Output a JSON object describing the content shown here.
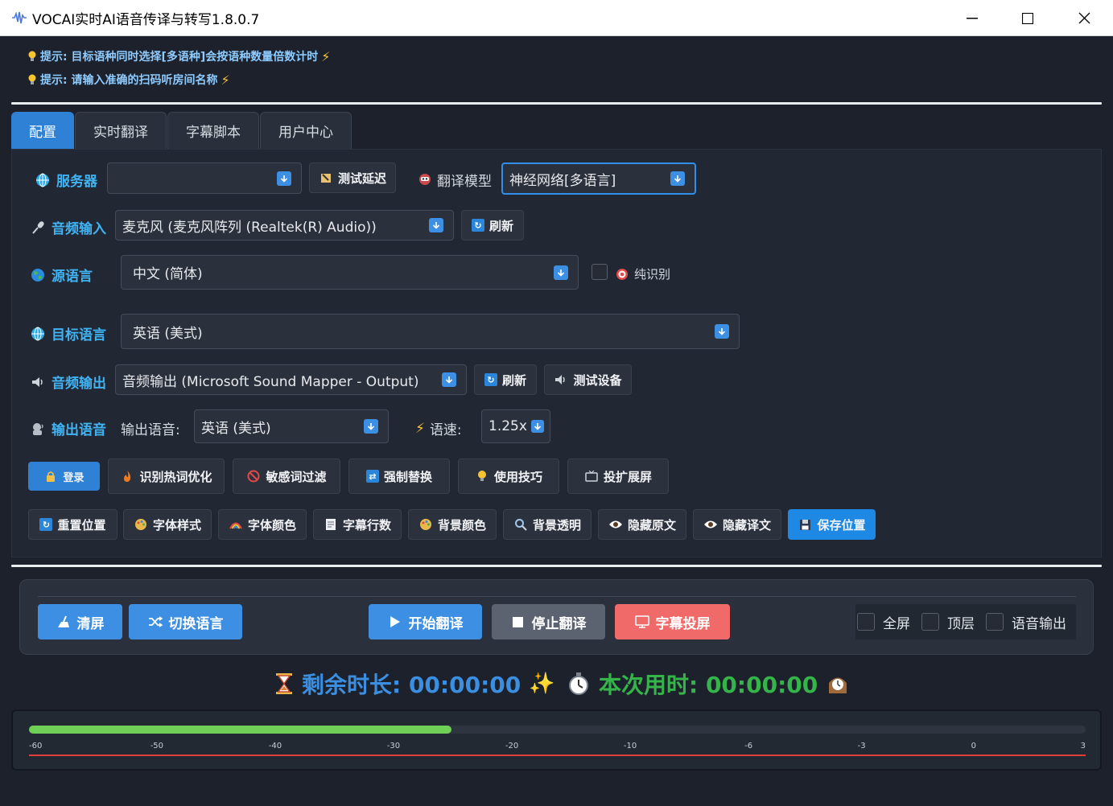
{
  "window": {
    "title": "VOCAI实时AI语音传译与转写1.8.0.7"
  },
  "tips": [
    "提示: 目标语种同时选择[多语种]会按语种数量倍数计时",
    "提示: 请输入准确的扫码听房间名称"
  ],
  "tabs": [
    "配置",
    "实时翻译",
    "字幕脚本",
    "用户中心"
  ],
  "config": {
    "server_label": "服务器",
    "server_value": "",
    "test_latency": "测试延迟",
    "model_label": "翻译模型",
    "model_value": "神经网络[多语言]",
    "audio_in_label": "音频输入",
    "audio_in_value": "麦克风 (麦克风阵列 (Realtek(R) Audio))",
    "refresh": "刷新",
    "source_label": "源语言",
    "source_value": "中文 (简体)",
    "pure_recog": "纯识别",
    "target_label": "目标语言",
    "target_value": "英语 (美式)",
    "audio_out_label": "音频输出",
    "audio_out_value": "音频输出 (Microsoft Sound Mapper - Output)",
    "test_device": "测试设备",
    "voice_label": "输出语音",
    "voice_sub_label": "输出语音:",
    "voice_value": "英语 (美式)",
    "speed_label": "语速:",
    "speed_value": "1.25x"
  },
  "row_buttons_1": [
    "登录",
    "识别热词优化",
    "敏感词过滤",
    "强制替换",
    "使用技巧",
    "投扩展屏"
  ],
  "row_buttons_2": [
    "重置位置",
    "字体样式",
    "字体颜色",
    "字幕行数",
    "背景颜色",
    "背景透明",
    "隐藏原文",
    "隐藏译文",
    "保存位置"
  ],
  "controls": {
    "clear": "清屏",
    "switch_lang": "切换语言",
    "start": "开始翻译",
    "stop": "停止翻译",
    "project": "字幕投屏",
    "fullscreen": "全屏",
    "topmost": "顶层",
    "voice_output": "语音输出"
  },
  "timers": {
    "remaining": "剩余时长: 00:00:00",
    "elapsed": "本次用时: 00:00:00"
  },
  "meter": {
    "level_fraction": 0.4,
    "ticks": [
      "-60",
      "-50",
      "-40",
      "-30",
      "-20",
      "-10",
      "-6",
      "-3",
      "0",
      "3"
    ]
  },
  "colors": {
    "accent": "#2f81d6",
    "label_blue": "#41b3f2",
    "danger": "#f06a6a",
    "remaining": "#3b8ee0",
    "elapsed": "#35b44a",
    "meter_fill": "#6fcf56"
  }
}
